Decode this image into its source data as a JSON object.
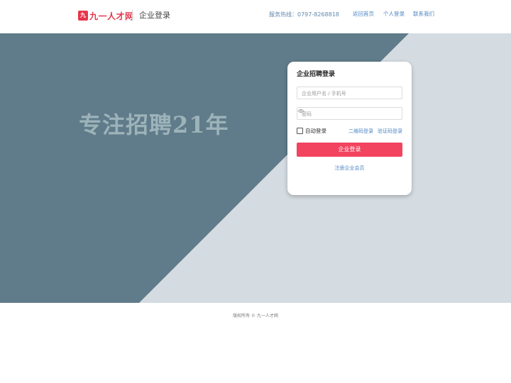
{
  "header": {
    "logo_mark": "九一",
    "logo_text": "九一人才网",
    "page_tag": "企业登录",
    "hotline": "服务热线：0797-8268818",
    "nav": [
      "返回首页",
      "个人登录",
      "联系我们"
    ]
  },
  "banner": {
    "slogan": "专注招聘21年",
    "colors": {
      "dark": "#607b89",
      "light": "#d4dce1",
      "slogan": "#9db3ba"
    }
  },
  "login": {
    "title": "企业招聘登录",
    "username_placeholder": "企业用户名 / 手机号",
    "password_placeholder": "密码",
    "auto_login_label": "自动登录",
    "auto_login_checked": false,
    "qr_login_link": "二维码登录",
    "code_login_link": "验证码登录",
    "submit_label": "企业登录",
    "register_link": "注册企业会员"
  },
  "footer": {
    "copyright": "版权所有 © 九一人才网"
  },
  "colors": {
    "accent": "#f2445f",
    "link": "#4f86c2",
    "brand": "#e6364b"
  }
}
